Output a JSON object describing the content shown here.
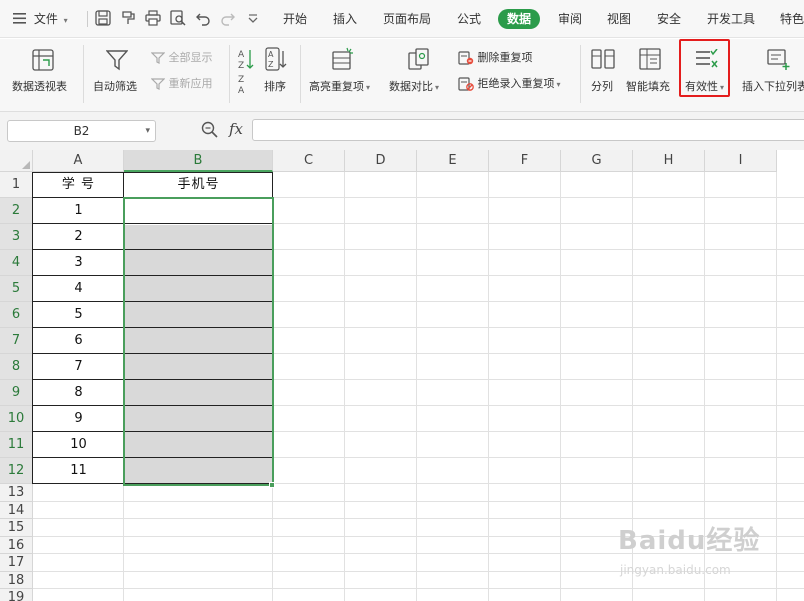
{
  "menubar": {
    "file_label": "文件",
    "tabs": [
      "开始",
      "插入",
      "页面布局",
      "公式",
      "数据",
      "审阅",
      "视图",
      "安全",
      "开发工具",
      "特色"
    ],
    "active_tab": "数据"
  },
  "ribbon": {
    "pivot": "数据透视表",
    "autofilter": "自动筛选",
    "show_all": "全部显示",
    "reapply": "重新应用",
    "sort": "排序",
    "highlight_dup": "高亮重复项",
    "compare": "数据对比",
    "remove_dup": "删除重复项",
    "reject_dup": "拒绝录入重复项",
    "split": "分列",
    "smart_fill": "智能填充",
    "validity": "有效性",
    "insert_dropdown": "插入下拉列表"
  },
  "formula": {
    "name_box": "B2",
    "fx": "fx",
    "value": ""
  },
  "sheet": {
    "columns": [
      "A",
      "B",
      "C",
      "D",
      "E",
      "F",
      "G",
      "H",
      "I"
    ],
    "rows": [
      "1",
      "2",
      "3",
      "4",
      "5",
      "6",
      "7",
      "8",
      "9",
      "10",
      "11",
      "12",
      "13",
      "14",
      "15",
      "16",
      "17",
      "18",
      "19"
    ],
    "header_a": "学 号",
    "header_b": "手机号",
    "ids": [
      "1",
      "2",
      "3",
      "4",
      "5",
      "6",
      "7",
      "8",
      "9",
      "10",
      "11"
    ]
  },
  "watermark": {
    "main": "Baidu经验",
    "sub": "jingyan.baidu.com"
  }
}
